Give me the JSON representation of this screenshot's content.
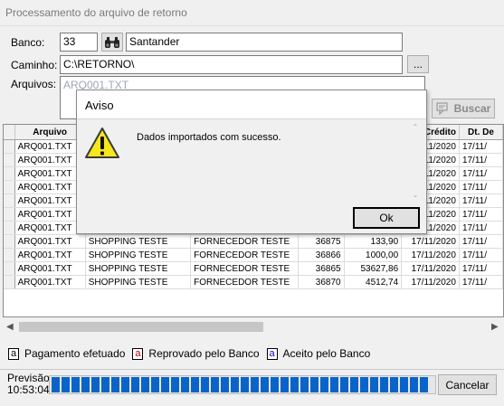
{
  "window": {
    "title": "Processamento do arquivo de retorno"
  },
  "form": {
    "banco_label": "Banco:",
    "banco_code": "33",
    "banco_name": "Santander",
    "caminho_label": "Caminho:",
    "caminho_value": "C:\\RETORNO\\",
    "browse_label": "...",
    "arquivos_label": "Arquivos:",
    "arquivos_item": "ARQ001.TXT",
    "buscar_label": "Buscar"
  },
  "grid": {
    "headers": [
      "Arquivo",
      "",
      "",
      "",
      "",
      ". Crédito",
      "Dt. De"
    ],
    "rows": [
      [
        "ARQ001.TXT",
        "",
        "",
        "",
        "",
        "7/11/2020",
        "17/11/"
      ],
      [
        "ARQ001.TXT",
        "",
        "",
        "",
        "",
        "7/11/2020",
        "17/11/"
      ],
      [
        "ARQ001.TXT",
        "",
        "",
        "",
        "",
        "7/11/2020",
        "17/11/"
      ],
      [
        "ARQ001.TXT",
        "",
        "",
        "",
        "",
        "7/11/2020",
        "17/11/"
      ],
      [
        "ARQ001.TXT",
        "",
        "",
        "",
        "",
        "7/11/2020",
        "17/11/"
      ],
      [
        "ARQ001.TXT",
        "",
        "",
        "",
        "",
        "7/11/2020",
        "17/11/"
      ],
      [
        "ARQ001.TXT",
        "",
        "",
        "",
        "",
        "7/11/2020",
        "17/11/"
      ],
      [
        "ARQ001.TXT",
        "SHOPPING TESTE",
        "FORNECEDOR TESTE",
        "36875",
        "133,90",
        "17/11/2020",
        "17/11/"
      ],
      [
        "ARQ001.TXT",
        "SHOPPING TESTE",
        "FORNECEDOR TESTE",
        "36866",
        "1000,00",
        "17/11/2020",
        "17/11/"
      ],
      [
        "ARQ001.TXT",
        "SHOPPING TESTE",
        "FORNECEDOR TESTE",
        "36865",
        "53627,86",
        "17/11/2020",
        "17/11/"
      ],
      [
        "ARQ001.TXT",
        "SHOPPING TESTE",
        "FORNECEDOR TESTE",
        "36870",
        "4512,74",
        "17/11/2020",
        "17/11/"
      ]
    ]
  },
  "legend": {
    "items": [
      {
        "mark": "a",
        "label": "Pagamento efetuado",
        "color": "#000000"
      },
      {
        "mark": "a",
        "label": "Reprovado pelo Banco",
        "color": "#c00000"
      },
      {
        "mark": "a",
        "label": "Aceito pelo Banco",
        "color": "#0000c0"
      }
    ]
  },
  "status": {
    "previsao_label": "Previsão",
    "previsao_time": "10:53:04",
    "cancel_label": "Cancelar"
  },
  "dialog": {
    "title": "Aviso",
    "message": "Dados importados com sucesso.",
    "ok_label": "Ok"
  },
  "colors": {
    "progress": "#0a64c8",
    "selection": "#0078d7"
  }
}
